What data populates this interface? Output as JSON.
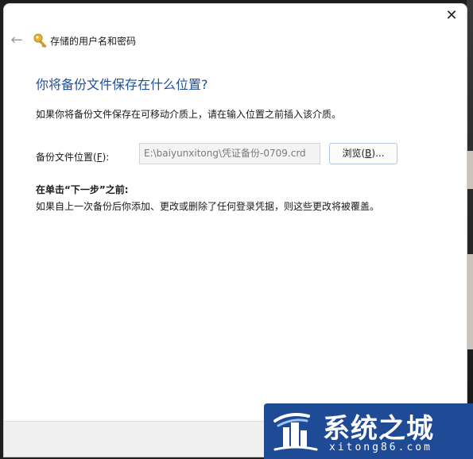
{
  "window": {
    "title": "存储的用户名和密码",
    "close_glyph": "✕",
    "back_glyph": "←",
    "icon": "key-icon"
  },
  "content": {
    "heading": "你将备份文件保存在什么位置?",
    "description": "如果你将备份文件保存在可移动介质上，请在输入位置之前插入该介质。",
    "field_label_prefix": "备份文件位置(",
    "field_label_key": "F",
    "field_label_suffix": "):",
    "path_value": "E:\\baiyunxitong\\凭证备份-0709.crd",
    "browse_prefix": "浏览(",
    "browse_key": "B",
    "browse_suffix": ")...",
    "warning_title": "在单击“下一步”之前:",
    "warning_text": "如果自上一次备份后你添加、更改或删除了任何登录凭据，则这些更改将被覆盖。"
  },
  "watermark": {
    "brand": "系统之城",
    "url": "xitong86.com"
  },
  "colors": {
    "heading": "#1f4e9a",
    "watermark_bg": "#1f4a96"
  }
}
